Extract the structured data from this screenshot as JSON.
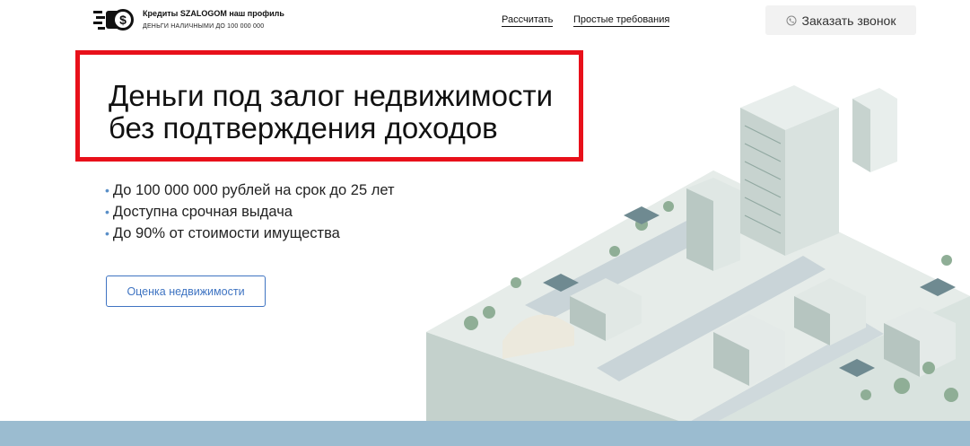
{
  "header": {
    "brand_title": "Кредиты SZALOGOM наш профиль",
    "brand_sub": "ДЕНЬГИ НАЛИЧНЫМИ ДО 100 000 000",
    "nav": [
      {
        "label": "Рассчитать"
      },
      {
        "label": "Простые требования"
      }
    ],
    "call_label": "Заказать звонок"
  },
  "hero": {
    "title_line1": "Деньги под залог недвижимости",
    "title_line2": "без подтверждения доходов"
  },
  "features": [
    "До 100 000 000 рублей на срок до 25 лет",
    "Доступна срочная выдача",
    "До 90% от стоимости имущества"
  ],
  "cta": {
    "eval_label": "Оценка недвижимости"
  },
  "colors": {
    "accent_red": "#e8101a",
    "accent_blue": "#3f74c2",
    "footer_band": "#9bbcd0"
  }
}
